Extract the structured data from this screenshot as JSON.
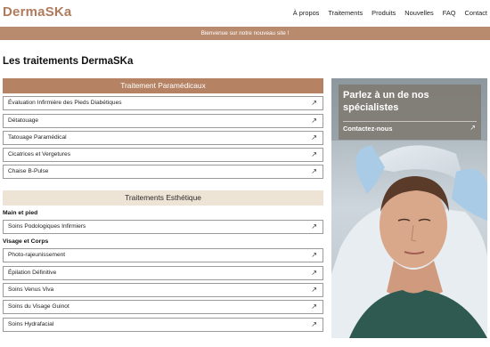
{
  "header": {
    "logo": "DermaSKa",
    "nav": [
      "À propos",
      "Traitements",
      "Produits",
      "Nouvelles",
      "FAQ",
      "Contact"
    ]
  },
  "banner": {
    "text": "Bienvenue sur notre nouveau site !"
  },
  "page": {
    "title": "Les traitements DermaSKa"
  },
  "paramedical": {
    "title": "Traitement Paramédicaux",
    "items": [
      "Évaluation Infirmière des Pieds Diabétiques",
      "Détatouage",
      "Tatouage Paramédical",
      "Cicatrices et Vergetures",
      "Chaise B-Pulse"
    ]
  },
  "esthetic": {
    "title": "Traitements Esthétique",
    "groups": [
      {
        "heading": "Main et pied",
        "items": [
          "Soins Podologiques Infirmiers"
        ]
      },
      {
        "heading": "Visage et Corps",
        "items": [
          "Photo-rajeunissement",
          "Épilation Définitive",
          "Soins Venus Viva",
          "Soins du Visage Guinot",
          "Soins Hydrafacial"
        ]
      }
    ]
  },
  "sidebar_card": {
    "title": "Parlez à un de nos spécialistes",
    "link": "Contactez-nous"
  },
  "icons": {
    "item_arrow": "arrow-up-right-icon"
  },
  "colors": {
    "brand": "#b07a5c",
    "banner": "#b98b6e",
    "para_header": "#b58363",
    "esth_header": "#eee4d6"
  }
}
